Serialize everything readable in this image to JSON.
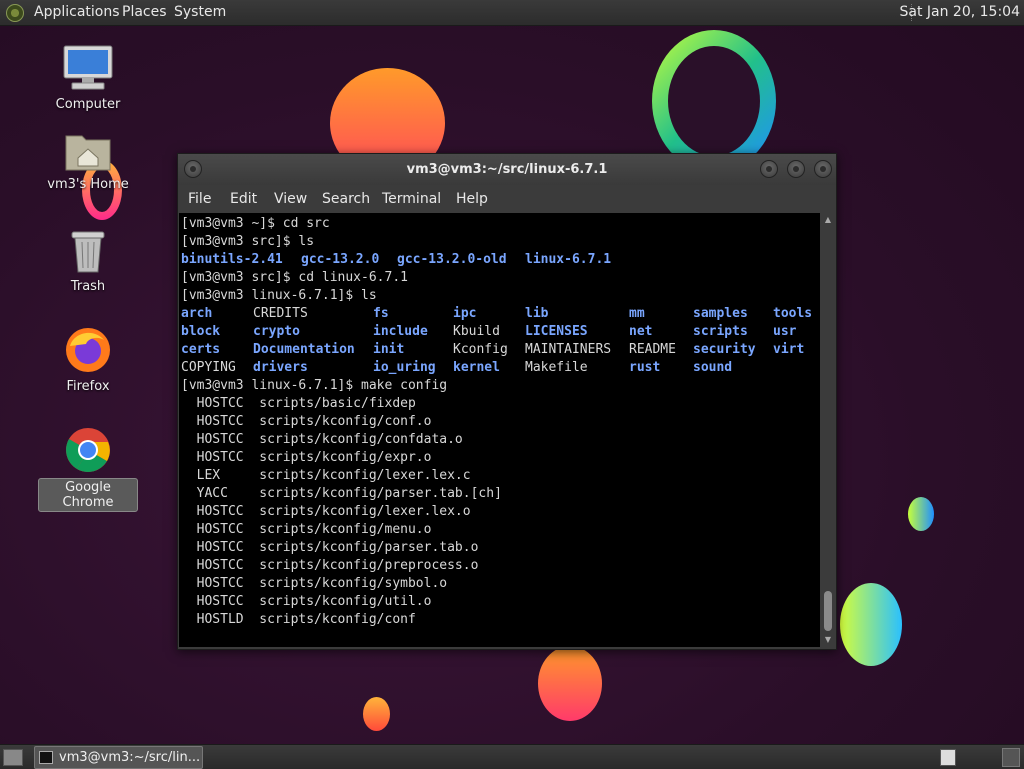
{
  "top_panel": {
    "menus": [
      "Applications",
      "Places",
      "System"
    ],
    "clock": "Sat Jan 20, 15:04"
  },
  "desktop_icons": [
    {
      "label": "Computer",
      "icon": "computer-icon"
    },
    {
      "label": "vm3's Home",
      "icon": "home-folder-icon"
    },
    {
      "label": "Trash",
      "icon": "trash-icon"
    },
    {
      "label": "Firefox",
      "icon": "firefox-icon"
    },
    {
      "label": "Google Chrome",
      "icon": "chrome-icon",
      "selected": true
    }
  ],
  "terminal": {
    "title": "vm3@vm3:~/src/linux-6.7.1",
    "menu": [
      "File",
      "Edit",
      "View",
      "Search",
      "Terminal",
      "Help"
    ],
    "lines": [
      {
        "cells": [
          {
            "t": "[vm3@vm3 ~]$ cd src"
          }
        ]
      },
      {
        "cells": [
          {
            "t": "[vm3@vm3 src]$ ls"
          }
        ]
      },
      {
        "cells": [
          {
            "t": "binutils-2.41",
            "d": true
          },
          {
            "t": "gcc-13.2.0",
            "d": true
          },
          {
            "t": "gcc-13.2.0-old",
            "d": true
          },
          {
            "t": "linux-6.7.1",
            "d": true
          }
        ],
        "cols": [
          0,
          15,
          27,
          43
        ]
      },
      {
        "cells": [
          {
            "t": "[vm3@vm3 src]$ cd linux-6.7.1"
          }
        ]
      },
      {
        "cells": [
          {
            "t": "[vm3@vm3 linux-6.7.1]$ ls"
          }
        ]
      },
      {
        "cells": [
          {
            "t": "arch",
            "d": true
          },
          {
            "t": "CREDITS"
          },
          {
            "t": "fs",
            "d": true
          },
          {
            "t": "ipc",
            "d": true
          },
          {
            "t": "lib",
            "d": true
          },
          {
            "t": "mm",
            "d": true
          },
          {
            "t": "samples",
            "d": true
          },
          {
            "t": "tools",
            "d": true
          }
        ],
        "cols": [
          0,
          9,
          24,
          34,
          43,
          56,
          64,
          74
        ]
      },
      {
        "cells": [
          {
            "t": "block",
            "d": true
          },
          {
            "t": "crypto",
            "d": true
          },
          {
            "t": "include",
            "d": true
          },
          {
            "t": "Kbuild"
          },
          {
            "t": "LICENSES",
            "d": true
          },
          {
            "t": "net",
            "d": true
          },
          {
            "t": "scripts",
            "d": true
          },
          {
            "t": "usr",
            "d": true
          }
        ],
        "cols": [
          0,
          9,
          24,
          34,
          43,
          56,
          64,
          74
        ]
      },
      {
        "cells": [
          {
            "t": "certs",
            "d": true
          },
          {
            "t": "Documentation",
            "d": true
          },
          {
            "t": "init",
            "d": true
          },
          {
            "t": "Kconfig"
          },
          {
            "t": "MAINTAINERS"
          },
          {
            "t": "README"
          },
          {
            "t": "security",
            "d": true
          },
          {
            "t": "virt",
            "d": true
          }
        ],
        "cols": [
          0,
          9,
          24,
          34,
          43,
          56,
          64,
          74
        ]
      },
      {
        "cells": [
          {
            "t": "COPYING"
          },
          {
            "t": "drivers",
            "d": true
          },
          {
            "t": "io_uring",
            "d": true
          },
          {
            "t": "kernel",
            "d": true
          },
          {
            "t": "Makefile"
          },
          {
            "t": "rust",
            "d": true
          },
          {
            "t": "sound",
            "d": true
          }
        ],
        "cols": [
          0,
          9,
          24,
          34,
          43,
          56,
          64
        ]
      },
      {
        "cells": [
          {
            "t": "[vm3@vm3 linux-6.7.1]$ make config"
          }
        ]
      },
      {
        "cells": [
          {
            "t": "  HOSTCC  scripts/basic/fixdep"
          }
        ]
      },
      {
        "cells": [
          {
            "t": "  HOSTCC  scripts/kconfig/conf.o"
          }
        ]
      },
      {
        "cells": [
          {
            "t": "  HOSTCC  scripts/kconfig/confdata.o"
          }
        ]
      },
      {
        "cells": [
          {
            "t": "  HOSTCC  scripts/kconfig/expr.o"
          }
        ]
      },
      {
        "cells": [
          {
            "t": "  LEX     scripts/kconfig/lexer.lex.c"
          }
        ]
      },
      {
        "cells": [
          {
            "t": "  YACC    scripts/kconfig/parser.tab.[ch]"
          }
        ]
      },
      {
        "cells": [
          {
            "t": "  HOSTCC  scripts/kconfig/lexer.lex.o"
          }
        ]
      },
      {
        "cells": [
          {
            "t": "  HOSTCC  scripts/kconfig/menu.o"
          }
        ]
      },
      {
        "cells": [
          {
            "t": "  HOSTCC  scripts/kconfig/parser.tab.o"
          }
        ]
      },
      {
        "cells": [
          {
            "t": "  HOSTCC  scripts/kconfig/preprocess.o"
          }
        ]
      },
      {
        "cells": [
          {
            "t": "  HOSTCC  scripts/kconfig/symbol.o"
          }
        ]
      },
      {
        "cells": [
          {
            "t": "  HOSTCC  scripts/kconfig/util.o"
          }
        ]
      },
      {
        "cells": [
          {
            "t": "  HOSTLD  scripts/kconfig/conf"
          }
        ]
      }
    ]
  },
  "taskbar": {
    "task_label": "vm3@vm3:~/src/lin..."
  },
  "colors": {
    "dir": "#7aa6ff",
    "text": "#d8d8d8",
    "panel": "#333333"
  }
}
